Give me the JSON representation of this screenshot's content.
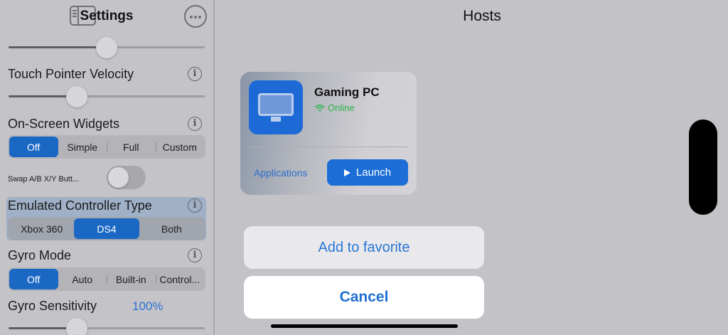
{
  "sidebar": {
    "title": "Settings",
    "touch_pointer_velocity": {
      "label": "Touch Pointer Velocity"
    },
    "onscreen_widgets": {
      "label": "On-Screen Widgets",
      "options": [
        "Off",
        "Simple",
        "Full",
        "Custom"
      ],
      "selected": "Off"
    },
    "swap_buttons": {
      "label": "Swap A/B X/Y Butt...",
      "enabled": false
    },
    "controller_type": {
      "label": "Emulated Controller Type",
      "options": [
        "Xbox 360",
        "DS4",
        "Both"
      ],
      "selected": "DS4"
    },
    "gyro_mode": {
      "label": "Gyro Mode",
      "options": [
        "Off",
        "Auto",
        "Built-in",
        "Control..."
      ],
      "selected": "Off"
    },
    "gyro_sensitivity": {
      "label": "Gyro Sensitivity",
      "value": "100%"
    },
    "info_glyph": "i"
  },
  "main": {
    "title": "Hosts",
    "host": {
      "name": "Gaming PC",
      "status": "Online",
      "icon": "monitor-icon",
      "applications_label": "Applications",
      "launch_label": "Launch"
    },
    "actions": {
      "favorite_label": "Add to favorite",
      "cancel_label": "Cancel"
    }
  },
  "colors": {
    "accent": "#1a68c4",
    "online": "#2ab24a",
    "background": "#c3c2c7"
  }
}
